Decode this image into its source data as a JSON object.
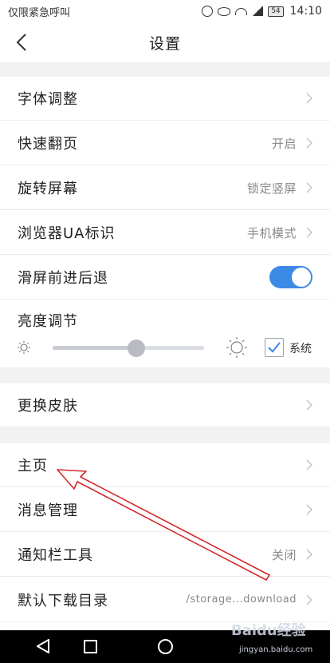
{
  "status_bar": {
    "carrier_text": "仅限紧急呼叫",
    "battery": "54",
    "time": "14:10"
  },
  "header": {
    "title": "设置"
  },
  "settings": {
    "font_adjust": {
      "label": "字体调整"
    },
    "fast_flip": {
      "label": "快速翻页",
      "value": "开启"
    },
    "rotate_screen": {
      "label": "旋转屏幕",
      "value": "锁定竖屏"
    },
    "browser_ua": {
      "label": "浏览器UA标识",
      "value": "手机模式"
    },
    "swipe_nav": {
      "label": "滑屏前进后退",
      "enabled": true
    },
    "brightness": {
      "label": "亮度调节",
      "level": 0.55,
      "system_label": "系统",
      "system_checked": true
    },
    "change_skin": {
      "label": "更换皮肤"
    },
    "homepage": {
      "label": "主页"
    },
    "message_mgmt": {
      "label": "消息管理"
    },
    "notification_tools": {
      "label": "通知栏工具",
      "value": "关闭"
    },
    "download_dir": {
      "label": "默认下载目录",
      "value": "/storage...download"
    }
  },
  "watermark": {
    "text": "Baidu经验",
    "sub": "jingyan.baidu.com"
  },
  "colors": {
    "accent": "#3d8ae6",
    "annotation_arrow": "#d42a2a",
    "section_gap": "#f2f2f2"
  }
}
